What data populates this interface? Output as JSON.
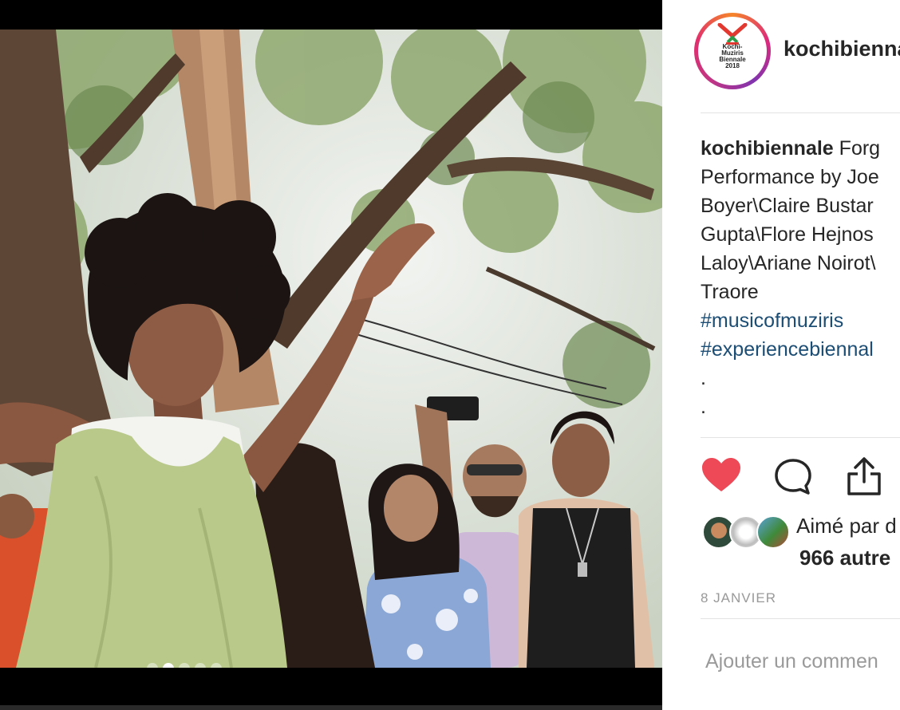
{
  "post": {
    "username": "kochibiennale",
    "avatar_logo_lines": [
      "Kochi-",
      "Muziris",
      "Biennale",
      "2018"
    ],
    "caption": {
      "user": "kochibiennale",
      "lines": [
        "Forg",
        "Performance by Joe",
        "Boyer\\Claire Bustar",
        "Gupta\\Flore Hejnos",
        "Laloy\\Ariane Noirot\\",
        "Traore"
      ],
      "hashtags": [
        "#musicofmuziris",
        "#experiencebiennal"
      ],
      "trailing_dots": [
        ".",
        "."
      ]
    },
    "likes": {
      "label": "Aimé par d",
      "count_text": "966 autre"
    },
    "date": "8 JANVIER",
    "comment_placeholder": "Ajouter un commen",
    "carousel": {
      "count": 5,
      "active_index": 1
    }
  },
  "colors": {
    "like_red": "#ed4956",
    "hashtag_blue": "#1c4d74",
    "muted_gray": "#999999"
  },
  "icons": [
    "heart-icon",
    "comment-icon",
    "share-icon"
  ]
}
